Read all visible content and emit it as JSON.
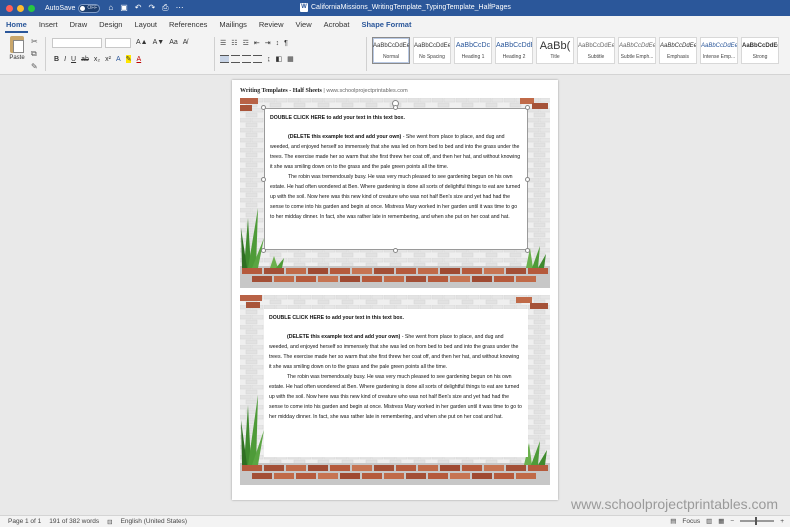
{
  "titlebar": {
    "autosave_label": "AutoSave",
    "autosave_state": "OFF",
    "document_title": "CaliforniaMissions_WritingTemplate_TypingTemplate_HalfPages",
    "icons": [
      "home-icon",
      "save-icon",
      "undo-icon",
      "redo-icon",
      "print-icon",
      "more-icon"
    ]
  },
  "tabs": [
    "Home",
    "Insert",
    "Draw",
    "Design",
    "Layout",
    "References",
    "Mailings",
    "Review",
    "View",
    "Acrobat",
    "Shape Format"
  ],
  "ribbon": {
    "paste_label": "Paste",
    "styles": [
      {
        "sample": "AaBbCcDdEe",
        "name": "Normal"
      },
      {
        "sample": "AaBbCcDdEe",
        "name": "No Spacing"
      },
      {
        "sample": "AaBbCcDc",
        "name": "Heading 1"
      },
      {
        "sample": "AaBbCcDdE",
        "name": "Heading 2"
      },
      {
        "sample": "AaBb(",
        "name": "Title"
      },
      {
        "sample": "AaBbCcDdEe",
        "name": "Subtitle"
      },
      {
        "sample": "AaBbCcDdEe",
        "name": "Subtle Emph..."
      },
      {
        "sample": "AaBbCcDdEe",
        "name": "Emphasis"
      },
      {
        "sample": "AaBbCcDdEe",
        "name": "Intense Emp..."
      },
      {
        "sample": "AaBbCcDdEe",
        "name": "Strong"
      }
    ]
  },
  "document": {
    "header_title": "Writing Templates - Half Sheets",
    "header_url": "| www.schoolprojectprintables.com",
    "textbox_heading": "DOUBLE CLICK HERE to add your text in this text box.",
    "para1_bold": "(DELETE this example text and add your own)",
    "para1_rest": " - She went from place to place, and dug and weeded, and enjoyed herself so immensely that she was led on from bed to bed and into the grass under the trees. The exercise made her so warm that she first threw her coat off, and then her hat, and without knowing it she was smiling down on to the grass and the pale green points all the time.",
    "para2": "The robin was tremendously busy. He was very much pleased to see gardening begun on his own estate. He had often wondered at Ben. Where gardening is done all sorts of delightful things to eat are turned up with the soil. Now here was this new kind of creature who was not half Ben's size and yet had had the sense to come into his garden and begin at once. Mistress Mary worked in her garden until it was time to go to her midday dinner. In fact, she was rather late in remembering, and when she put on her coat and hat."
  },
  "status": {
    "page": "Page 1 of 1",
    "words": "191 of 382 words",
    "language": "English (United States)",
    "focus": "Focus"
  },
  "watermark": "www.schoolprojectprintables.com",
  "colors": {
    "accent": "#2b579a",
    "brick": "#b55a3c",
    "leaf": "#3f8a2e"
  }
}
